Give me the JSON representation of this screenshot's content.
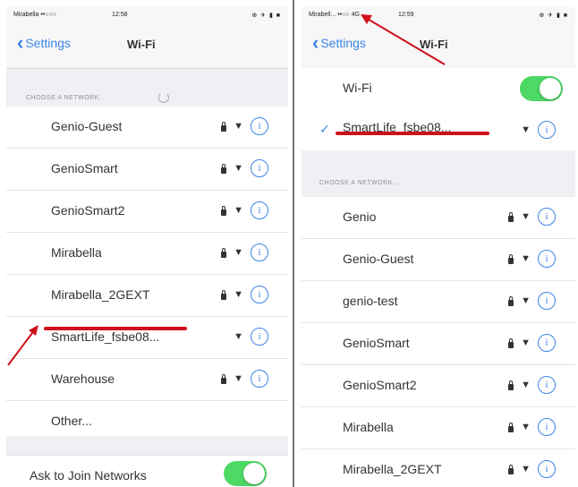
{
  "left": {
    "status": {
      "carrier": "Mirabella ••○○○",
      "time": "12:58",
      "right": "⊕ ✈ ▮ ■"
    },
    "nav": {
      "back": "Settings",
      "title": "Wi-Fi"
    },
    "section": "CHOOSE A NETWORK...",
    "networks": [
      {
        "name": "Genio-Guest",
        "locked": true
      },
      {
        "name": "GenioSmart",
        "locked": true
      },
      {
        "name": "GenioSmart2",
        "locked": true
      },
      {
        "name": "Mirabella",
        "locked": true
      },
      {
        "name": "Mirabella_2GEXT",
        "locked": true
      },
      {
        "name": "SmartLife_fsbe08...",
        "locked": false
      },
      {
        "name": "Warehouse",
        "locked": true
      },
      {
        "name": "Other...",
        "locked": false,
        "other": true
      }
    ],
    "ask_label": "Ask to Join Networks"
  },
  "right": {
    "status": {
      "carrier": "Mirabell... ••○○ 4G",
      "time": "12:59",
      "right": "⊕ ✈ ▮ ■"
    },
    "nav": {
      "back": "Settings",
      "title": "Wi-Fi"
    },
    "wifi_label": "Wi-Fi",
    "connected": "SmartLife_fsbe08...",
    "section": "CHOOSE A NETWORK...",
    "networks": [
      {
        "name": "Genio",
        "locked": true
      },
      {
        "name": "Genio-Guest",
        "locked": true
      },
      {
        "name": "genio-test",
        "locked": true
      },
      {
        "name": "GenioSmart",
        "locked": true
      },
      {
        "name": "GenioSmart2",
        "locked": true
      },
      {
        "name": "Mirabella",
        "locked": true
      },
      {
        "name": "Mirabella_2GEXT",
        "locked": true
      }
    ]
  },
  "colors": {
    "accent": "#3b86e6",
    "toggle_on": "#4cd964",
    "annotation": "#d0101c"
  },
  "icons": {
    "lock": "lock-icon",
    "wifi": "wifi-icon",
    "info": "info-icon",
    "check": "checkmark-icon",
    "back": "chevron-left-icon"
  }
}
